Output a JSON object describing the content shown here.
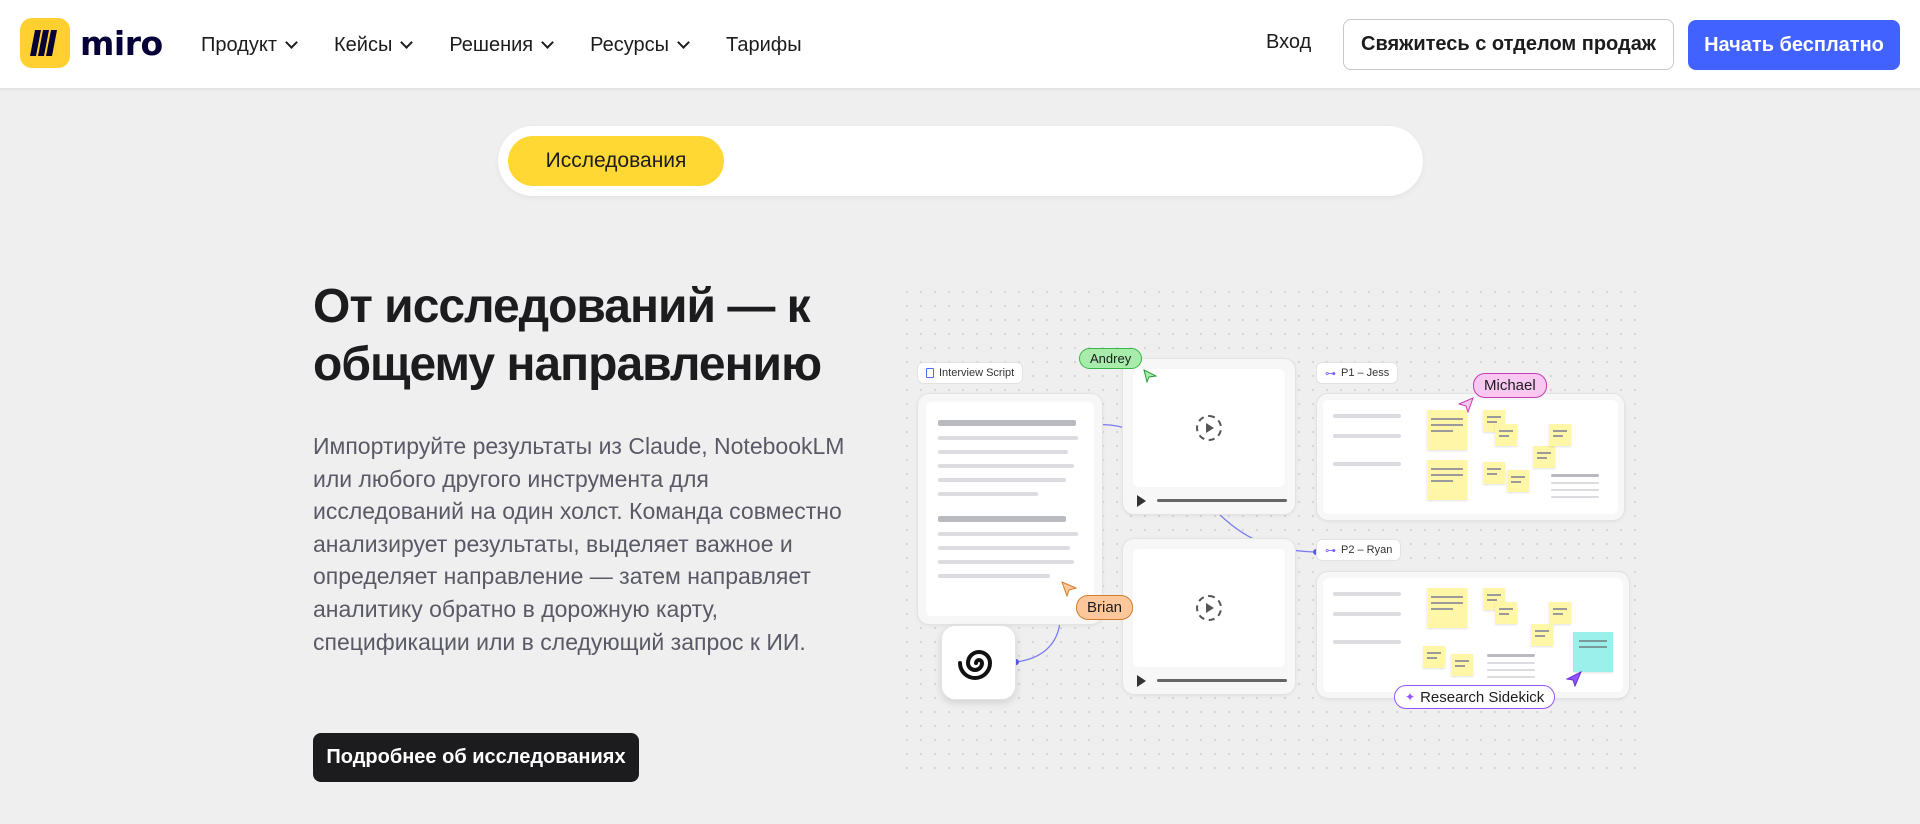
{
  "header": {
    "logo_text": "miro",
    "nav": [
      {
        "label": "Продукт",
        "has_dropdown": true
      },
      {
        "label": "Кейсы",
        "has_dropdown": true
      },
      {
        "label": "Решения",
        "has_dropdown": true
      },
      {
        "label": "Ресурсы",
        "has_dropdown": true
      },
      {
        "label": "Тарифы",
        "has_dropdown": false
      }
    ],
    "login_label": "Вход",
    "sales_button": "Свяжитесь с отделом продаж",
    "start_button": "Начать бесплатно"
  },
  "tabs": {
    "active_label": "Исследования"
  },
  "hero": {
    "title": "От исследований — к общему направлению",
    "body": "Импортируйте результаты из Claude, NotebookLM или любого другого инструмента для исследований на один холст. Команда совместно анализирует результаты, выделяет важное и определяет направление — затем направляет аналитику обратно в дорожную карту, спецификации или в следующий запрос к ИИ.",
    "cta_label": "Подробнее об исследованиях"
  },
  "illustration": {
    "interview_chip": "Interview Script",
    "p1_chip": "P1 – Jess",
    "p2_chip": "P2 – Ryan",
    "cursor_andrey": "Andrey",
    "cursor_michael": "Michael",
    "cursor_brian": "Brian",
    "sidekick_label": "Research Sidekick"
  },
  "colors": {
    "primary": "#4262ff",
    "logo_yellow": "#ffd02f",
    "tab_active": "#ffd834",
    "andrey_tag": "#a8ecac",
    "michael_tag": "#f8c8f0",
    "brian_tag": "#fbc79b",
    "sidekick_border": "#9254ff"
  }
}
